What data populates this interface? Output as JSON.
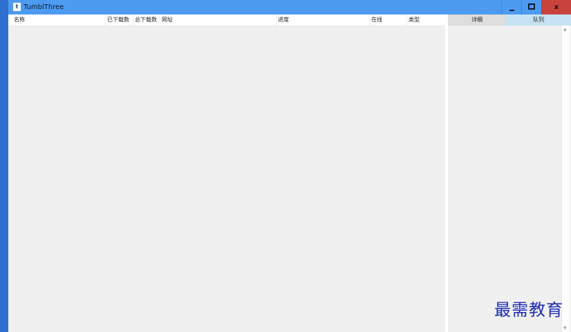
{
  "window": {
    "title": "TumblThree",
    "app_icon_glyph": "t",
    "controls": {
      "minimize_icon": "minimize-icon",
      "maximize_icon": "maximize-icon",
      "close_label": "x"
    }
  },
  "list": {
    "columns": [
      "名称",
      "已下载数",
      "总下载数",
      "网址",
      "进度",
      "在线",
      "类型"
    ],
    "rows": []
  },
  "detail_panel": {
    "tabs": [
      "详细",
      "队列"
    ],
    "active_tab": "队列"
  },
  "watermark": "最需教育",
  "colors": {
    "titlebar": "#4d9bf0",
    "close_button": "#c8433b",
    "window_border": "#2e6fd0",
    "background": "#f0f0f0",
    "active_tab": "#c7e3f3",
    "watermark": "#1c2bb4"
  }
}
